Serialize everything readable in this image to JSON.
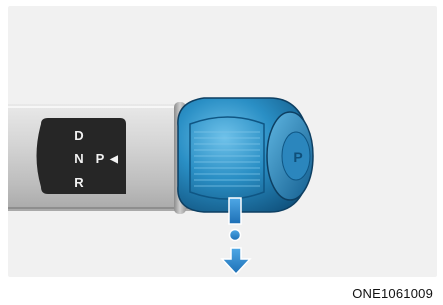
{
  "figure": {
    "caption": "ONE1061009",
    "indicator": {
      "letters": [
        "D",
        "N",
        "P",
        "R"
      ],
      "active": "P",
      "active_marker": "◀"
    },
    "park_button_symbol": "P",
    "colors": {
      "background": "#f1f1f1",
      "lever_body": "#cfcfcf",
      "indicator_panel": "#2a2a2a",
      "knob_blue": "#1f7fb4",
      "arrow_blue": "#2a8ad0"
    },
    "icons": {
      "press_arrow": "arrow-down-icon",
      "park_button": "park-button-icon"
    }
  }
}
